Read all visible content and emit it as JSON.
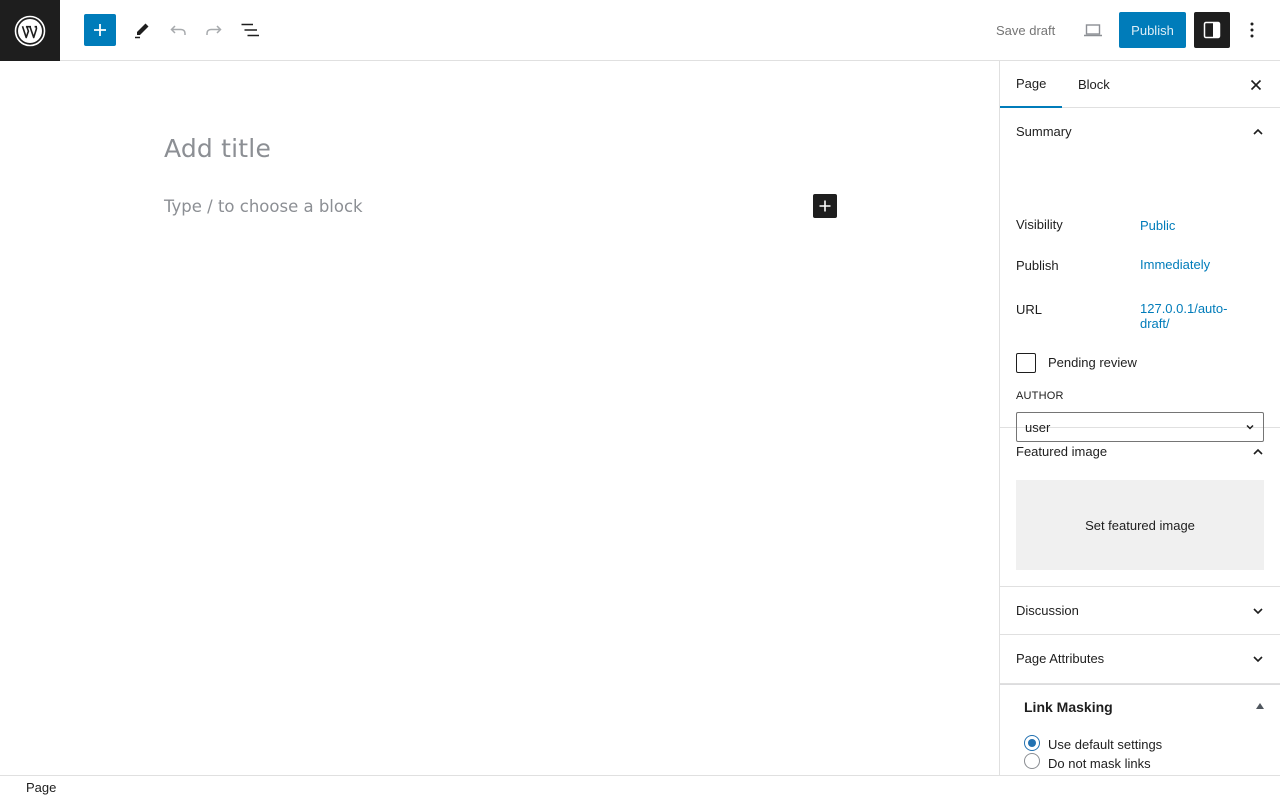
{
  "toolbar": {
    "add_block_icon": "plus-icon",
    "tools_icon": "pencil-icon",
    "undo_icon": "undo-icon",
    "redo_icon": "redo-icon",
    "list_view_icon": "list-view-icon",
    "save_draft_label": "Save draft",
    "preview_icon": "desktop-preview-icon",
    "publish_label": "Publish",
    "settings_icon": "sidebar-toggle-icon",
    "options_icon": "more-vertical-icon"
  },
  "editor": {
    "title_placeholder": "Add title",
    "block_placeholder": "Type / to choose a block"
  },
  "sidebar": {
    "tabs": [
      {
        "label": "Page",
        "active": true
      },
      {
        "label": "Block",
        "active": false
      }
    ],
    "summary": {
      "title": "Summary",
      "expanded": true,
      "visibility_label": "Visibility",
      "visibility_value": "Public",
      "publish_label": "Publish",
      "publish_value": "Immediately",
      "url_label": "URL",
      "url_value_line1": "127.0.0.1/auto-",
      "url_value_line2": "draft/",
      "pending_review_label": "Pending review",
      "pending_review_checked": false,
      "author_label": "AUTHOR",
      "author_value": "user"
    },
    "featured_image": {
      "title": "Featured image",
      "expanded": true,
      "button_label": "Set featured image"
    },
    "discussion": {
      "title": "Discussion",
      "expanded": false
    },
    "page_attributes": {
      "title": "Page Attributes",
      "expanded": false
    },
    "link_masking": {
      "title": "Link Masking",
      "options": [
        {
          "label": "Use default settings",
          "checked": true
        },
        {
          "label": "Do not mask links",
          "checked": false
        }
      ]
    }
  },
  "footer": {
    "breadcrumb": "Page"
  },
  "colors": {
    "accent": "#007cba",
    "dark": "#1e1e1e",
    "placeholder": "#8c8f94"
  }
}
